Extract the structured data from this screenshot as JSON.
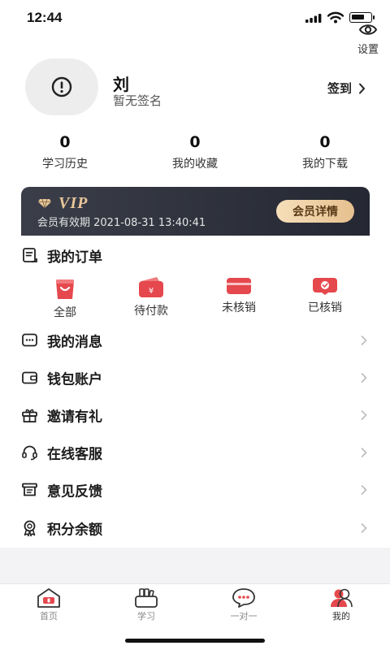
{
  "status_bar": {
    "time": "12:44"
  },
  "header": {
    "settings_label": "设置"
  },
  "profile": {
    "name": "刘",
    "signature": "暂无签名",
    "checkin_label": "签到"
  },
  "stats": [
    {
      "value": "0",
      "label": "学习历史"
    },
    {
      "value": "0",
      "label": "我的收藏"
    },
    {
      "value": "0",
      "label": "我的下载"
    }
  ],
  "vip": {
    "badge": "VIP",
    "expiry": "会员有效期 2021-08-31 13:40:41",
    "button": "会员详情"
  },
  "orders": {
    "title": "我的订单",
    "items": [
      {
        "label": "全部",
        "icon": "bag-icon"
      },
      {
        "label": "待付款",
        "icon": "wallet-icon"
      },
      {
        "label": "未核销",
        "icon": "card-icon"
      },
      {
        "label": "已核销",
        "icon": "verified-icon"
      }
    ]
  },
  "menu": [
    {
      "label": "我的消息",
      "icon": "message-icon"
    },
    {
      "label": "钱包账户",
      "icon": "wallet-icon"
    },
    {
      "label": "邀请有礼",
      "icon": "gift-icon"
    },
    {
      "label": "在线客服",
      "icon": "headset-icon"
    },
    {
      "label": "意见反馈",
      "icon": "feedback-icon"
    },
    {
      "label": "积分余额",
      "icon": "medal-icon"
    }
  ],
  "tabs": [
    {
      "label": "首页",
      "icon": "home-icon"
    },
    {
      "label": "学习",
      "icon": "books-icon"
    },
    {
      "label": "一对一",
      "icon": "chat-icon"
    },
    {
      "label": "我的",
      "icon": "user-icon"
    }
  ],
  "colors": {
    "accent_red": "#e5484d",
    "vip_gold": "#e9c79a",
    "vip_bg": "#2b2e38"
  }
}
